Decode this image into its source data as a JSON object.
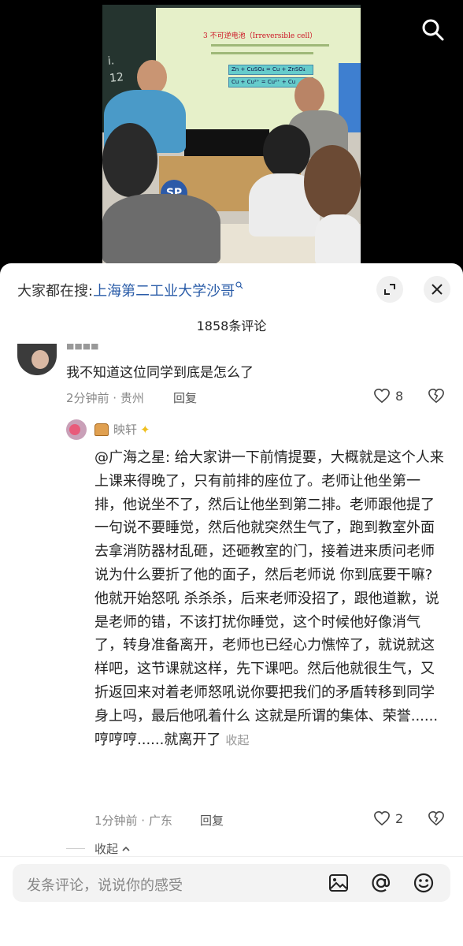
{
  "header": {
    "search_prefix": "大家都在搜:",
    "search_term": "上海第二工业大学沙哥",
    "search_icon": "search-icon",
    "expand_icon": "expand-icon",
    "close_icon": "close-icon"
  },
  "comments_count": "1858条评论",
  "video": {
    "board_text": "i.\n12",
    "slide_title": "3 不可逆电池（Irreversible cell）",
    "formula_discharge": "Zn + CuSO₄ = Cu + ZnSO₄",
    "formula_charge": "Cu + Cu²⁺ = Cu²⁺ + Cu",
    "logo_text": "SP"
  },
  "comment1": {
    "text": "我不知道这位同学到底是怎么了",
    "meta": "2分钟前 · 贵州",
    "reply_label": "回复",
    "likes": "8"
  },
  "reply1": {
    "username": "映轩",
    "paragraph": "@广海之星: 给大家讲一下前情提要，大概就是这个人来上课来得晚了，只有前排的座位了。老师让他坐第一排，他说坐不了，然后让他坐到第二排。老师跟他提了一句说不要睡觉，然后他就突然生气了，跑到教室外面去拿消防器材乱砸，还砸教室的门，接着进来质问老师说为什么要折了他的面子，然后老师说 你到底要干嘛? 他就开始怒吼 杀杀杀，后来老师没招了，跟他道歉，说是老师的错，不该打扰你睡觉，这个时候他好像消气了，转身准备离开，老师也已经心力憔悴了，就说就这样吧，这节课就这样，先下课吧。然后他就很生气，又折返回来对着老师怒吼说你要把我们的矛盾转移到同学身上吗，最后他吼着什么 这就是所谓的集体、荣誉......哼哼哼......就离开了",
    "collapse_label": "收起",
    "meta": "1分钟前 · 广东",
    "reply_label": "回复",
    "likes": "2"
  },
  "fold_label": "收起",
  "input": {
    "placeholder": "发条评论，说说你的感受"
  },
  "colors": {
    "link": "#2a5ca8",
    "muted": "#888888"
  }
}
